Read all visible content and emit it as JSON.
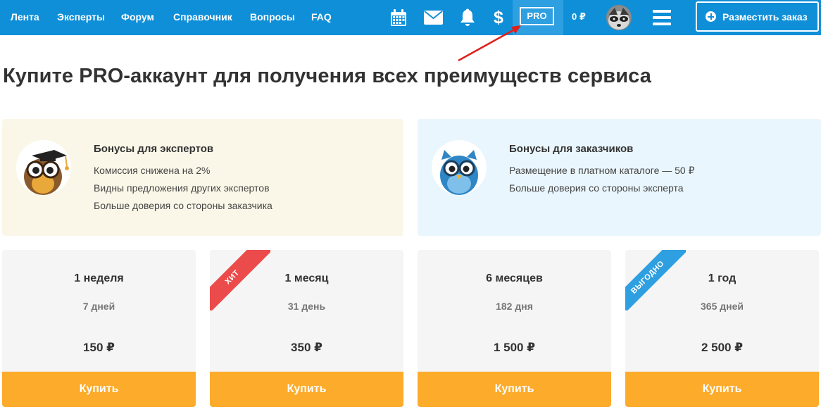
{
  "nav": {
    "links": [
      "Лента",
      "Эксперты",
      "Форум",
      "Справочник",
      "Вопросы",
      "FAQ"
    ],
    "pro_badge": "PRO",
    "balance": "0 ₽",
    "order_button": "Разместить заказ",
    "icons": [
      "calendar-icon",
      "mail-icon",
      "bell-icon",
      "dollar-icon",
      "menu-icon"
    ]
  },
  "page": {
    "title": "Купите PRO-аккаунт для получения всех преимуществ сервиса"
  },
  "bonuses": [
    {
      "title": "Бонусы для экспертов",
      "items": [
        "Комиссия снижена на 2%",
        "Видны предложения других экспертов",
        "Больше доверия со стороны заказчика"
      ]
    },
    {
      "title": "Бонусы для заказчиков",
      "items": [
        "Размещение в платном каталоге — 50 ₽",
        "Больше доверия со стороны эксперта"
      ]
    }
  ],
  "plans": [
    {
      "name": "1 неделя",
      "days": "7 дней",
      "price": "150 ₽",
      "button": "Купить",
      "ribbon": ""
    },
    {
      "name": "1 месяц",
      "days": "31 день",
      "price": "350 ₽",
      "button": "Купить",
      "ribbon": "ХИТ"
    },
    {
      "name": "6 месяцев",
      "days": "182 дня",
      "price": "1 500 ₽",
      "button": "Купить",
      "ribbon": ""
    },
    {
      "name": "1 год",
      "days": "365 дней",
      "price": "2 500 ₽",
      "button": "Купить",
      "ribbon": "ВЫГОДНО"
    }
  ],
  "colors": {
    "topbar": "#0f8fd8",
    "accent_orange": "#fdab2a",
    "ribbon_red": "#ec4b4b",
    "ribbon_blue": "#2e9fe0",
    "annotation_arrow": "#e0201b"
  }
}
